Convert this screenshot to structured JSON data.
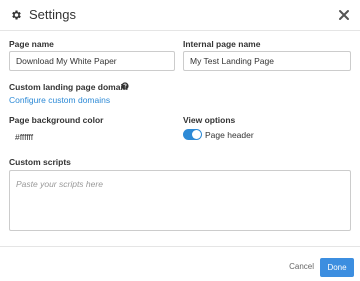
{
  "header": {
    "title": "Settings",
    "icon": "gear-icon",
    "close_icon": "close-icon"
  },
  "fields": {
    "page_name": {
      "label": "Page name",
      "value": "Download My White Paper"
    },
    "internal_page_name": {
      "label": "Internal page name",
      "value": "My Test Landing Page"
    },
    "custom_domain": {
      "label": "Custom landing page domain",
      "link": "Configure custom domains",
      "help_icon": "question-circle-icon"
    },
    "background_color": {
      "label": "Page background color",
      "value": "#ffffff"
    },
    "view_options": {
      "label": "View options",
      "toggle_label": "Page header",
      "toggle_on": true
    },
    "custom_scripts": {
      "label": "Custom scripts",
      "placeholder": "Paste your scripts here"
    }
  },
  "footer": {
    "cancel_label": "Cancel",
    "done_label": "Done"
  },
  "colors": {
    "accent": "#2d8ad6",
    "done_button": "#3c8ee0",
    "border": "#cccccc"
  }
}
